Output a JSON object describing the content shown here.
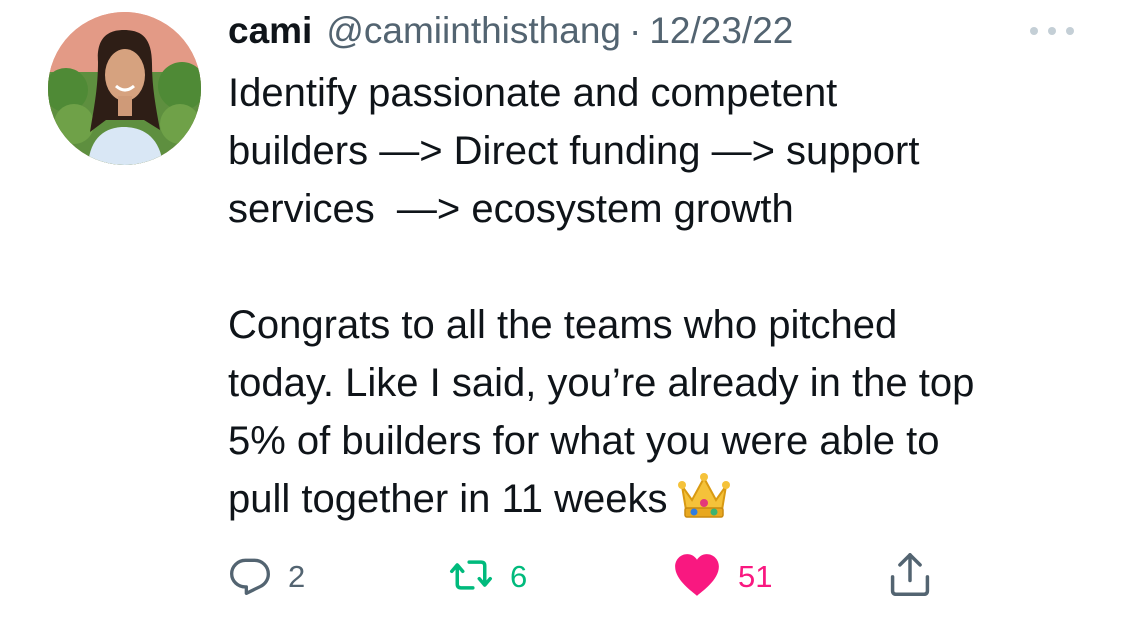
{
  "tweet": {
    "display_name": "cami",
    "handle": "@camiinthisthang",
    "separator": "·",
    "date": "12/23/22",
    "body_lines": [
      "Identify passionate and competent",
      "builders —> Direct funding —> support",
      "services  —> ecosystem growth",
      "Congrats to all the teams who pitched",
      "today. Like I said, you’re already in the top",
      "5% of builders for what you were able to",
      "pull together in 11 weeks"
    ]
  },
  "actions": {
    "reply_count": "2",
    "retweet_count": "6",
    "like_count": "51"
  },
  "icons": {
    "avatar": "avatar-photo",
    "more": "more-horizontal-icon",
    "reply": "reply-icon",
    "retweet": "retweet-icon",
    "like": "heart-icon",
    "share": "share-icon",
    "emoji": "crown-emoji"
  },
  "colors": {
    "text": "#0f1419",
    "muted": "#536471",
    "retweet": "#00ba7c",
    "like": "#f91880",
    "more_dots": "#c4cfd6"
  }
}
